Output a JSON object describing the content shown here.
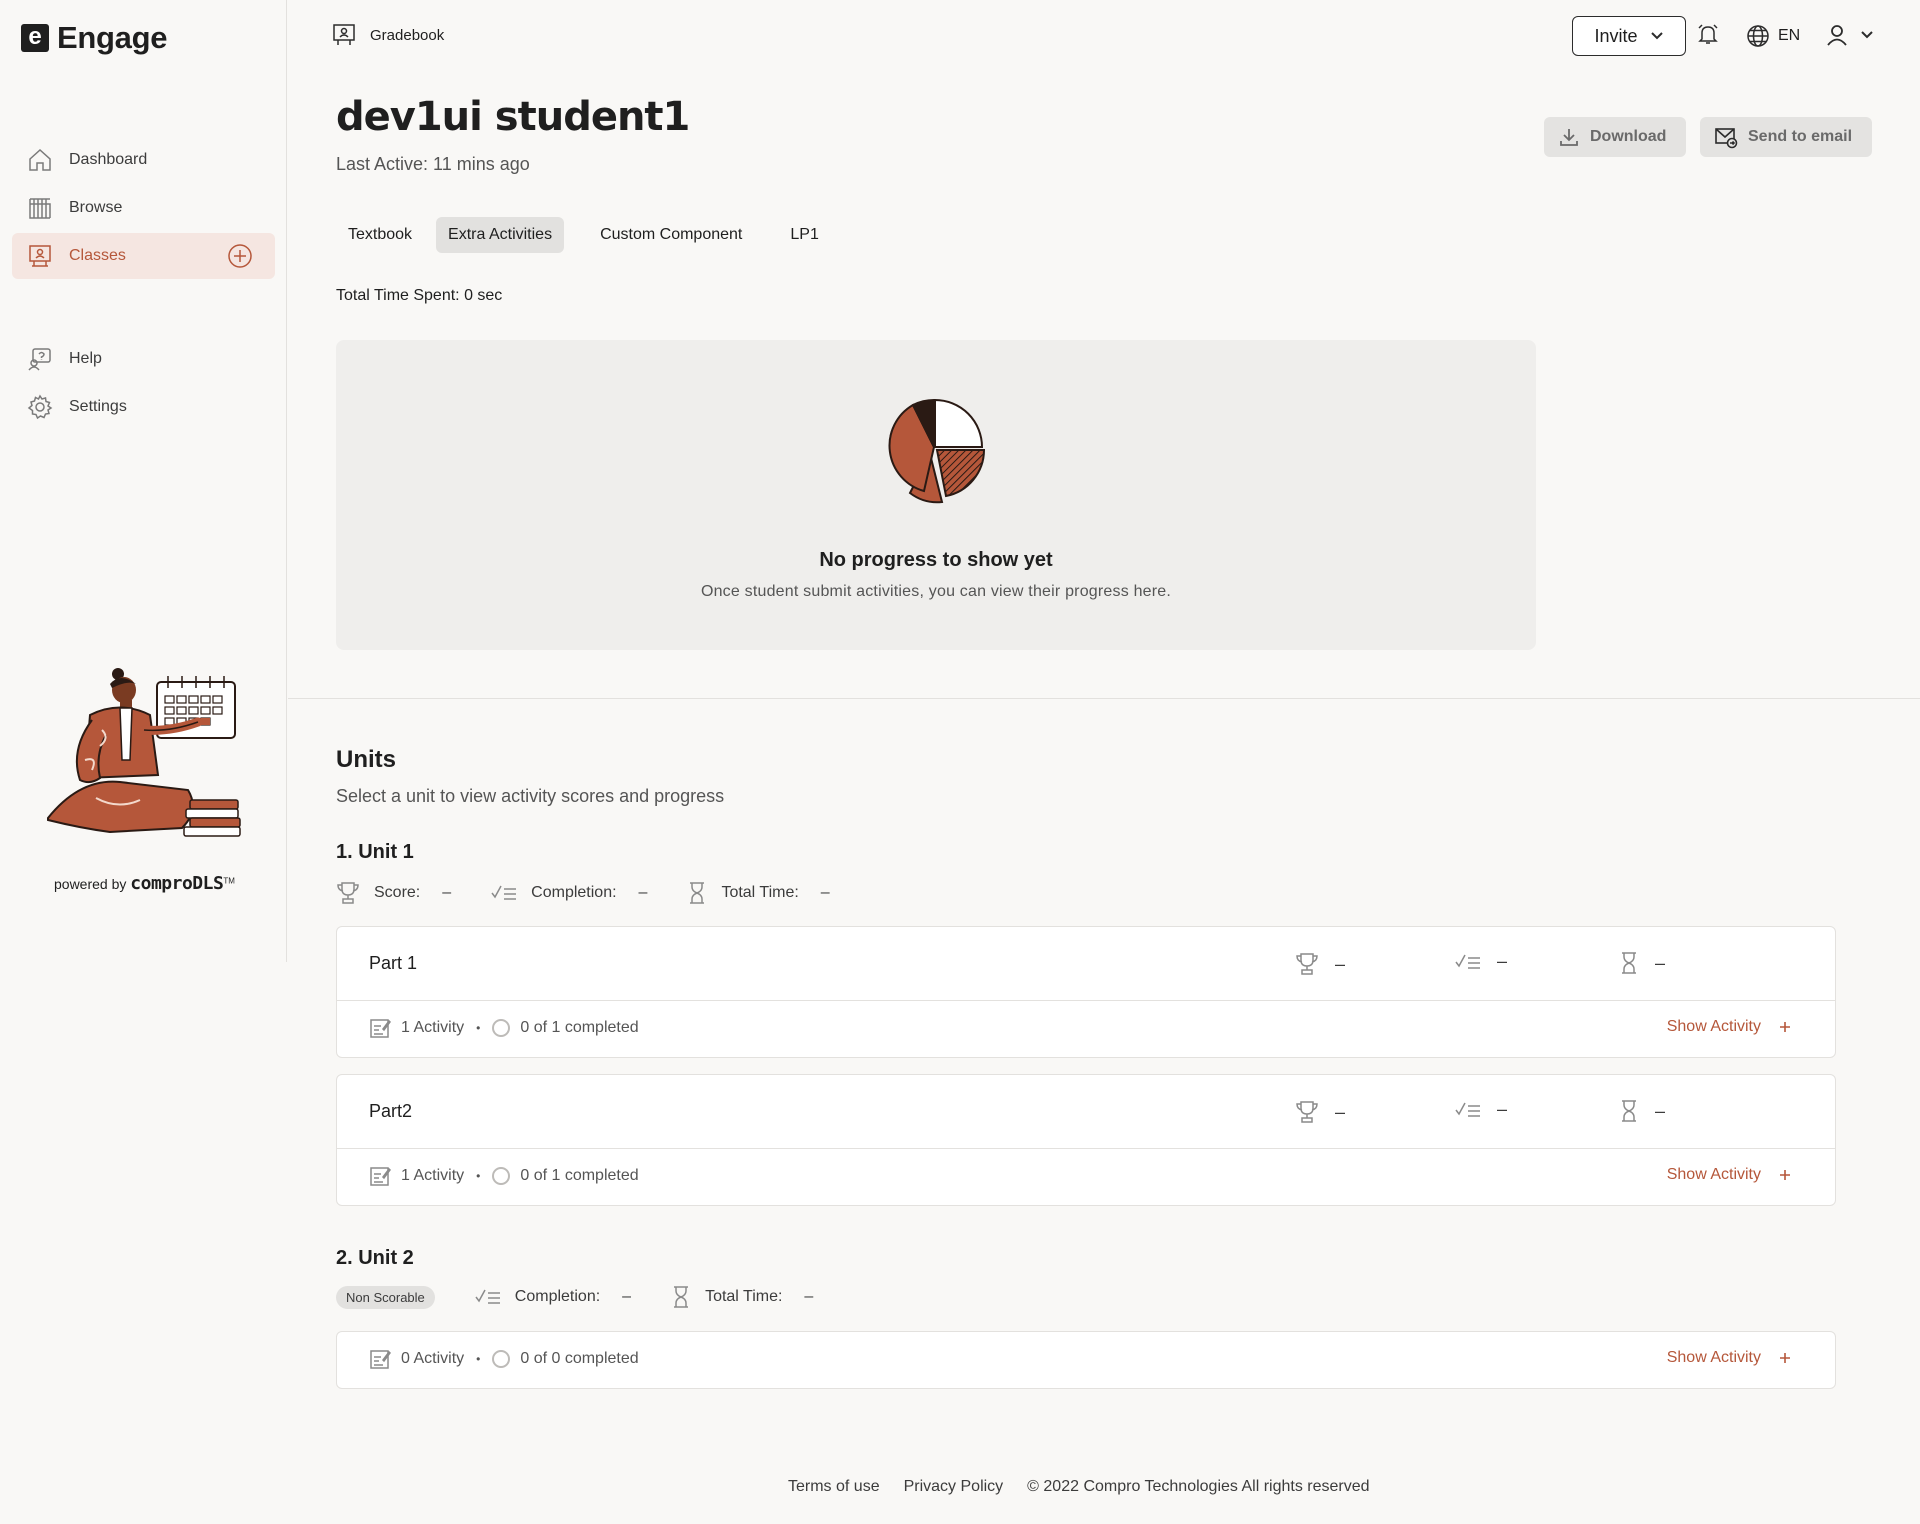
{
  "brand": {
    "logo_letter": "e",
    "name": "Engage"
  },
  "sidebar": {
    "items": [
      {
        "label": "Dashboard",
        "icon": "home-icon"
      },
      {
        "label": "Browse",
        "icon": "books-icon"
      },
      {
        "label": "Classes",
        "icon": "classroom-icon",
        "active": true
      },
      {
        "label": "Help",
        "icon": "help-icon"
      },
      {
        "label": "Settings",
        "icon": "gear-icon"
      }
    ],
    "powered_prefix": "powered by",
    "powered_brand": "comproDLS",
    "powered_tm": "TM"
  },
  "header": {
    "breadcrumb": "Gradebook",
    "invite_label": "Invite",
    "language": "EN"
  },
  "student": {
    "name": "dev1ui student1",
    "last_active": "Last Active: 11 mins ago"
  },
  "actions": {
    "download": "Download",
    "send_email": "Send to email"
  },
  "tabs": [
    "Textbook",
    "Extra Activities",
    "Custom Component",
    "LP1"
  ],
  "active_tab": "Extra Activities",
  "total_time": "Total Time Spent: 0 sec",
  "empty_state": {
    "title": "No progress to show yet",
    "subtitle": "Once student submit activities, you can view their progress here."
  },
  "units_section": {
    "title": "Units",
    "subtitle": "Select a unit to view activity scores and progress"
  },
  "units": [
    {
      "title": "1. Unit 1",
      "score_label": "Score:",
      "score": "–",
      "completion_label": "Completion:",
      "completion": "–",
      "time_label": "Total Time:",
      "time": "–",
      "parts": [
        {
          "name": "Part 1",
          "score": "–",
          "completion": "–",
          "time": "–",
          "activities": "1 Activity",
          "completed": "0 of 1 completed",
          "show": "Show Activity"
        },
        {
          "name": "Part2",
          "score": "–",
          "completion": "–",
          "time": "–",
          "activities": "1 Activity",
          "completed": "0 of 1 completed",
          "show": "Show Activity"
        }
      ]
    },
    {
      "title": "2. Unit 2",
      "chip": "Non Scorable",
      "completion_label": "Completion:",
      "completion": "–",
      "time_label": "Total Time:",
      "time": "–",
      "activities": "0 Activity",
      "completed": "0 of 0 completed",
      "show": "Show Activity"
    }
  ],
  "footer": {
    "terms": "Terms of use",
    "privacy": "Privacy Policy",
    "copyright": "© 2022 Compro Technologies All rights reserved"
  },
  "colors": {
    "accent": "#b5573a",
    "active_bg": "#f5e6e1",
    "background": "#f9f8f6"
  }
}
